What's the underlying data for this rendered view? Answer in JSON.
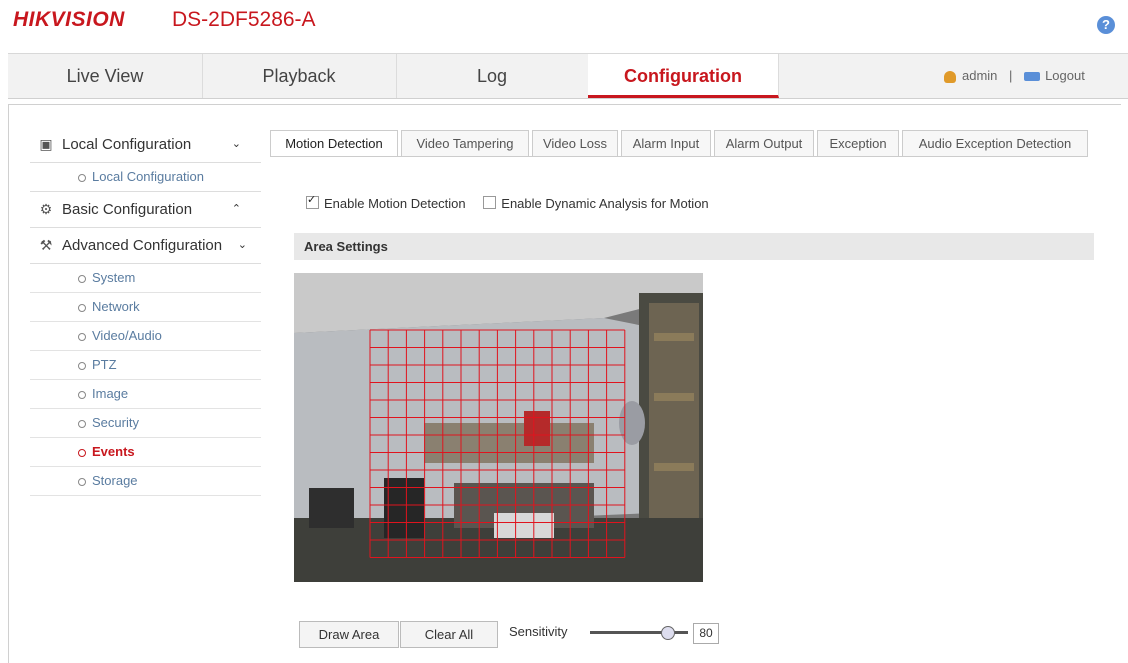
{
  "header": {
    "logo": "HIKVISION",
    "model": "DS-2DF5286-A",
    "help_icon": "question-icon"
  },
  "nav": {
    "tabs": [
      "Live View",
      "Playback",
      "Log",
      "Configuration"
    ],
    "active": "Configuration",
    "user": "admin",
    "separator": "|",
    "logout": "Logout"
  },
  "sidebar": {
    "sections": [
      {
        "label": "Local Configuration",
        "icon": "monitor-icon",
        "expanded": true
      },
      {
        "label": "Basic Configuration",
        "icon": "gear-icon",
        "expanded": false
      },
      {
        "label": "Advanced Configuration",
        "icon": "wrench-icon",
        "expanded": true
      }
    ],
    "local_items": [
      "Local Configuration"
    ],
    "advanced_items": [
      "System",
      "Network",
      "Video/Audio",
      "PTZ",
      "Image",
      "Security",
      "Events",
      "Storage"
    ],
    "active_item": "Events"
  },
  "content_tabs": [
    "Motion Detection",
    "Video Tampering",
    "Video Loss",
    "Alarm Input",
    "Alarm Output",
    "Exception",
    "Audio Exception Detection"
  ],
  "active_tab": "Motion Detection",
  "options": {
    "enable_motion": {
      "label": "Enable Motion Detection",
      "checked": true
    },
    "enable_dynamic": {
      "label": "Enable Dynamic Analysis for Motion",
      "checked": false
    }
  },
  "area_settings": {
    "title": "Area Settings"
  },
  "buttons": {
    "draw_area": "Draw Area",
    "clear_all": "Clear All"
  },
  "sensitivity": {
    "label": "Sensitivity",
    "value": "80",
    "level": 0.8
  },
  "colors": {
    "brand": "#c8171e",
    "grid": "#e0141e"
  }
}
